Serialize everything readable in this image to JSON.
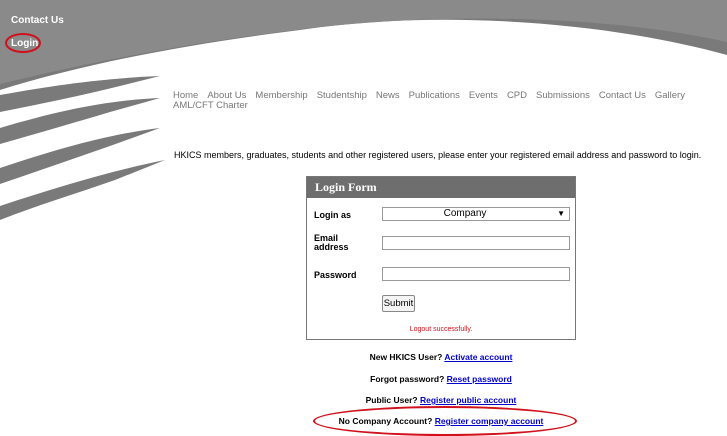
{
  "top_links": {
    "contact": "Contact Us",
    "login": "Login"
  },
  "nav": {
    "items": [
      "Home",
      "About Us",
      "Membership",
      "Studentship",
      "News",
      "Publications",
      "Events",
      "CPD",
      "Submissions",
      "Contact Us",
      "Gallery",
      "AML/CFT Charter"
    ]
  },
  "intro": "HKICS members, graduates, students and other registered users, please enter your registered email address and password to login.",
  "form": {
    "title": "Login Form",
    "login_as_label": "Login as",
    "login_as_value": "Company",
    "email_label_1": "Email",
    "email_label_2": "address",
    "email_value": "",
    "password_label": "Password",
    "password_value": "",
    "submit_label": "Submit",
    "status": "Logout successfully."
  },
  "links": {
    "new_user_text": "New HKICS User?",
    "new_user_link": "Activate account",
    "forgot_text": "Forgot password?",
    "forgot_link": "Reset password",
    "public_text": "Public User?",
    "public_link": "Register public account",
    "company_text": "No Company Account?",
    "company_link": "Register company account"
  },
  "colors": {
    "header_gray": "#6e6e6e",
    "highlight_red": "#d0101a",
    "link_blue": "#0000cc"
  }
}
